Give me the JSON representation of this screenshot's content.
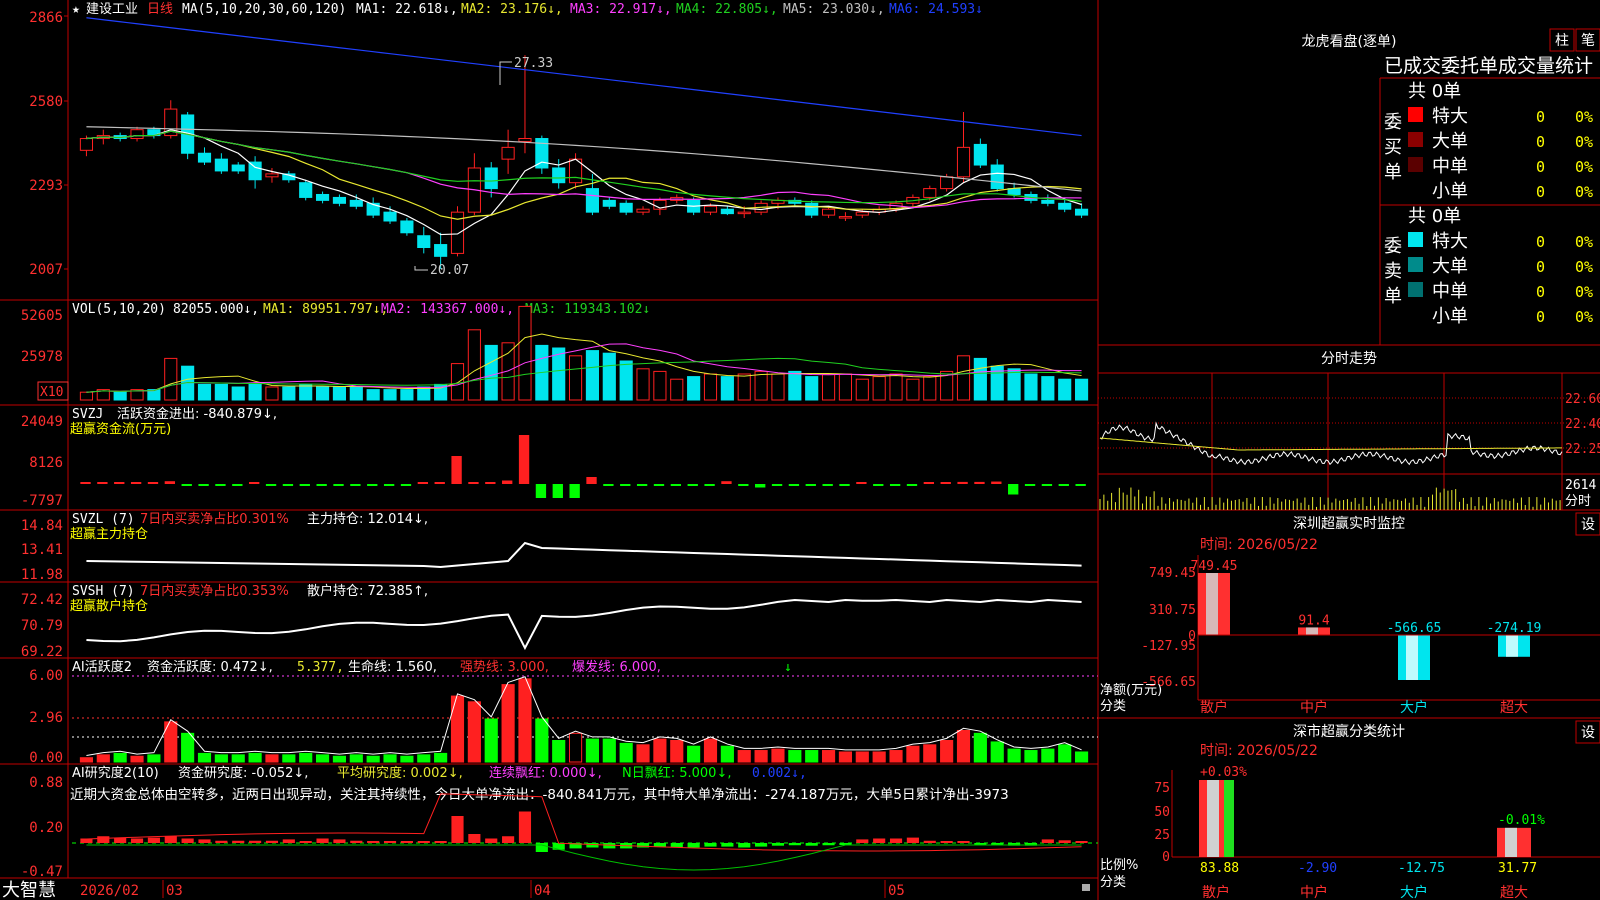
{
  "colors": {
    "up": "#ff2020",
    "down": "#00e5ee",
    "frame": "#c00000",
    "ma1": "#ffffff",
    "ma2": "#e8e830",
    "ma3": "#ff40ff",
    "ma4": "#20d020",
    "ma5": "#c0c0c0",
    "ma6": "#2040ff",
    "label_red": "#ff3030",
    "yellow": "#ffff00",
    "green": "#00ff00"
  },
  "footer": {
    "brand": "大智慧",
    "dates": [
      "2026/02",
      "03",
      "04",
      "05"
    ]
  },
  "kline": {
    "header": {
      "star": "★",
      "name": "建设工业",
      "period": "日线",
      "ma_def": "MA(5,10,20,30,60,120)",
      "ma1": "MA1: 22.618↓,",
      "ma2": "MA2: 23.176↓,",
      "ma3": "MA3: 22.917↓,",
      "ma4": "MA4: 22.805↓,",
      "ma5": "MA5: 23.030↓,",
      "ma6": "MA6: 24.593↓"
    },
    "yticks": [
      "2866",
      "2580",
      "2293",
      "2007"
    ],
    "high_label": "27.33",
    "low_label": "20.07"
  },
  "volume": {
    "header": {
      "def": "VOL(5,10,20)",
      "val": "82055.000↓,",
      "ma1": "MA1: 89951.797↓,",
      "ma2": "MA2: 143367.000↓,",
      "ma3": "MA3: 119343.102↓"
    },
    "yticks": [
      "52605",
      "25978"
    ],
    "unit": "X10"
  },
  "svzj": {
    "title": "SVZJ",
    "label": "活跃资金进出: -840.879↓,",
    "sub": "超赢资金流(万元)",
    "yticks": [
      "24049",
      "8126",
      "-7797"
    ]
  },
  "svzl": {
    "title": "SVZL (7)",
    "ratio": "7日内买卖净占比0.301%",
    "label": "主力持仓: 12.014↓,",
    "sub": "超赢主力持仓",
    "yticks": [
      "14.84",
      "13.41",
      "11.98"
    ]
  },
  "svsh": {
    "title": "SVSH (7)",
    "ratio": "7日内买卖净占比0.353%",
    "label": "散户持仓: 72.385↑,",
    "sub": "超赢散户持仓",
    "yticks": [
      "72.42",
      "70.79",
      "69.22"
    ]
  },
  "ai_active": {
    "title": "AI活跃度2",
    "a": "资金活跃度: 0.472↓,",
    "b": "5.377,",
    "c": "生命线: 1.560,",
    "d": "强势线: 3.000,",
    "e": "爆发线: 6.000,",
    "yticks": [
      "6.00",
      "2.96",
      "0.00"
    ]
  },
  "ai_research": {
    "title": "AI研究度2(10)",
    "a": "资金研究度: -0.052↓,",
    "b": "平均研究度: 0.002↓,",
    "c": "连续飘红: 0.000↓,",
    "d": "N日飘红: 5.000↓,",
    "e": "0.002↓,",
    "comment": "近期大资金总体由空转多，近两日出现异动，关注其持续性，今日大单净流出：-840.841万元，其中特大单净流出：-274.187万元，大单5日累计净出-3973",
    "yticks": [
      "0.88",
      "0.20",
      "-0.47"
    ]
  },
  "lhb": {
    "title": "龙虎看盘(逐单)",
    "btn1": "柱",
    "btn2": "笔",
    "header": "已成交委托单成交量统计",
    "buy_label": "委买单",
    "sell_label": "委卖单",
    "buy_total": "共 0单",
    "sell_total": "共 0单",
    "buy_rows": [
      {
        "name": "特大",
        "count": "0",
        "pct": "0%",
        "color": "#ff0000"
      },
      {
        "name": "大单",
        "count": "0",
        "pct": "0%",
        "color": "#8b0000"
      },
      {
        "name": "中单",
        "count": "0",
        "pct": "0%",
        "color": "#5a0000"
      },
      {
        "name": "小单",
        "count": "0",
        "pct": "0%",
        "color": ""
      }
    ],
    "sell_rows": [
      {
        "name": "特大",
        "count": "0",
        "pct": "0%",
        "color": "#00e5ee"
      },
      {
        "name": "大单",
        "count": "0",
        "pct": "0%",
        "color": "#008b8b"
      },
      {
        "name": "中单",
        "count": "0",
        "pct": "0%",
        "color": "#007070"
      },
      {
        "name": "小单",
        "count": "0",
        "pct": "0%",
        "color": ""
      }
    ]
  },
  "fenshi": {
    "title": "分时走势",
    "yticks": [
      "22.60",
      "22.40",
      "22.25"
    ],
    "vol_label": "2614",
    "unit_label": "分时"
  },
  "monitor": {
    "title": "深圳超赢实时监控",
    "btn": "设",
    "time": "时间: 2026/05/22",
    "yticks": [
      "749.45",
      "310.75",
      "0",
      "-127.95",
      "-566.65"
    ],
    "ylabel1": "净额(万元)",
    "ylabel2": "分类",
    "cats": [
      "散户",
      "中户",
      "大户",
      "超大"
    ],
    "values": [
      749.45,
      91.4,
      -566.65,
      -274.19
    ],
    "value_labels": [
      "749.45",
      "91.4",
      "-566.65",
      "-274.19"
    ]
  },
  "classify": {
    "title": "深市超赢分类统计",
    "btn": "设",
    "time": "时间: 2026/05/22",
    "yticks": [
      "75",
      "50",
      "25",
      "0"
    ],
    "ylabel1": "比例%",
    "ylabel2": "分类",
    "cats": [
      "散户",
      "中户",
      "大户",
      "超大"
    ],
    "values": [
      83.88,
      -2.9,
      -12.75,
      31.77
    ],
    "value_labels": [
      "83.88",
      "-2.90",
      "-12.75",
      "31.77"
    ],
    "change_labels": [
      "+0.03%",
      "",
      "",
      "-0.01%"
    ]
  },
  "chart_data": [
    {
      "type": "candlestick",
      "title": "建设工业 日线",
      "ylim": [
        20.07,
        28.66
      ],
      "high": 27.33,
      "low": 20.07,
      "x": [
        "2026/02",
        "03",
        "04",
        "05"
      ],
      "ma_last": {
        "MA1": 22.618,
        "MA2": 23.176,
        "MA3": 22.917,
        "MA4": 22.805,
        "MA5": 23.03,
        "MA6": 24.593
      },
      "ohlc": [
        [
          24.1,
          24.6,
          23.9,
          24.5
        ],
        [
          24.5,
          24.8,
          24.3,
          24.6
        ],
        [
          24.6,
          24.7,
          24.4,
          24.5
        ],
        [
          24.5,
          24.9,
          24.4,
          24.8
        ],
        [
          24.8,
          24.9,
          24.5,
          24.6
        ],
        [
          24.6,
          25.8,
          24.5,
          25.5
        ],
        [
          25.3,
          25.4,
          23.8,
          24.0
        ],
        [
          24.0,
          24.2,
          23.6,
          23.7
        ],
        [
          23.8,
          24.0,
          23.3,
          23.4
        ],
        [
          23.6,
          23.7,
          23.3,
          23.4
        ],
        [
          23.7,
          23.9,
          22.8,
          23.1
        ],
        [
          23.2,
          23.5,
          23.0,
          23.3
        ],
        [
          23.3,
          23.4,
          23.0,
          23.1
        ],
        [
          23.0,
          23.1,
          22.4,
          22.5
        ],
        [
          22.6,
          22.7,
          22.3,
          22.4
        ],
        [
          22.5,
          22.6,
          22.2,
          22.3
        ],
        [
          22.4,
          22.6,
          22.1,
          22.2
        ],
        [
          22.3,
          22.5,
          21.8,
          21.9
        ],
        [
          22.0,
          22.2,
          21.6,
          21.7
        ],
        [
          21.7,
          21.8,
          21.2,
          21.3
        ],
        [
          21.2,
          21.5,
          20.6,
          20.8
        ],
        [
          20.9,
          21.3,
          20.07,
          20.5
        ],
        [
          20.6,
          22.2,
          20.5,
          22.0
        ],
        [
          22.0,
          24.0,
          21.9,
          23.5
        ],
        [
          23.5,
          23.7,
          22.5,
          22.8
        ],
        [
          23.8,
          24.8,
          23.3,
          24.2
        ],
        [
          24.4,
          27.33,
          24.0,
          24.5
        ],
        [
          24.5,
          24.6,
          23.3,
          23.5
        ],
        [
          23.5,
          23.8,
          22.8,
          23.0
        ],
        [
          23.0,
          24.0,
          22.8,
          23.8
        ],
        [
          22.8,
          23.3,
          21.9,
          22.0
        ],
        [
          22.4,
          22.5,
          22.1,
          22.2
        ],
        [
          22.3,
          22.4,
          21.9,
          22.0
        ],
        [
          22.0,
          22.2,
          21.9,
          22.1
        ],
        [
          22.1,
          22.5,
          21.9,
          22.4
        ],
        [
          22.4,
          22.6,
          22.3,
          22.5
        ],
        [
          22.4,
          22.5,
          21.9,
          22.0
        ],
        [
          22.0,
          22.3,
          21.9,
          22.2
        ],
        [
          22.1,
          22.2,
          21.9,
          21.95
        ],
        [
          21.95,
          22.2,
          21.8,
          22.0
        ],
        [
          22.0,
          22.4,
          21.9,
          22.3
        ],
        [
          22.3,
          22.5,
          22.1,
          22.4
        ],
        [
          22.4,
          22.5,
          22.2,
          22.3
        ],
        [
          22.3,
          22.4,
          21.8,
          21.9
        ],
        [
          21.9,
          22.2,
          21.8,
          22.1
        ],
        [
          21.8,
          22.0,
          21.7,
          21.85
        ],
        [
          21.9,
          22.1,
          21.8,
          22.0
        ],
        [
          22.0,
          22.2,
          21.9,
          22.1
        ],
        [
          22.1,
          22.4,
          22.0,
          22.3
        ],
        [
          22.3,
          22.6,
          22.2,
          22.5
        ],
        [
          22.5,
          22.9,
          22.4,
          22.8
        ],
        [
          22.8,
          23.3,
          22.7,
          23.2
        ],
        [
          23.2,
          25.4,
          23.0,
          24.2
        ],
        [
          24.3,
          24.5,
          23.5,
          23.6
        ],
        [
          23.6,
          23.8,
          22.7,
          22.8
        ],
        [
          22.8,
          23.0,
          22.5,
          22.6
        ],
        [
          22.6,
          22.7,
          22.3,
          22.4
        ],
        [
          22.4,
          22.6,
          22.2,
          22.3
        ],
        [
          22.3,
          22.5,
          22.0,
          22.1
        ],
        [
          22.1,
          22.3,
          21.8,
          21.9
        ]
      ]
    },
    {
      "type": "bar",
      "title": "VOL(5,10,20)",
      "series": [
        {
          "name": "VOL",
          "values": [
            82055
          ]
        }
      ],
      "ma": {
        "MA1": 89951.797,
        "MA2": 143367.0,
        "MA3": 119343.102
      }
    },
    {
      "type": "bar",
      "title": "深圳超赢实时监控",
      "categories": [
        "散户",
        "中户",
        "大户",
        "超大"
      ],
      "values": [
        749.45,
        91.4,
        -566.65,
        -274.19
      ],
      "ylabel": "净额(万元)",
      "ylim": [
        -566.65,
        749.45
      ]
    },
    {
      "type": "bar",
      "title": "深市超赢分类统计",
      "categories": [
        "散户",
        "中户",
        "大户",
        "超大"
      ],
      "values": [
        83.88,
        -2.9,
        -12.75,
        31.77
      ],
      "ylabel": "比例%",
      "ylim": [
        0,
        75
      ]
    }
  ]
}
